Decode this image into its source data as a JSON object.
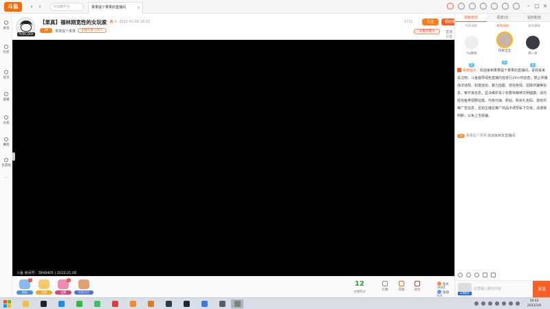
{
  "titlebar": {
    "logo": "斗鱼",
    "search_placeholder": "大仙魔平台",
    "tab_title": "果果提个果果的直播间",
    "tab_close": "×",
    "back": "‹",
    "forward": "›",
    "refresh": "↻",
    "minimize": "–",
    "maximize": "□",
    "close": "×"
  },
  "sidebar": {
    "items": [
      {
        "label": "关注",
        "icon": "heart-icon"
      },
      {
        "label": "历史",
        "icon": "clock-icon"
      },
      {
        "label": "首页",
        "icon": "home-icon"
      },
      {
        "label": "直播",
        "icon": "tv-icon"
      },
      {
        "label": "分类",
        "icon": "grid-icon"
      },
      {
        "label": "赛程",
        "icon": "trophy-icon"
      },
      {
        "label": "云游戏",
        "icon": "cloud-icon"
      }
    ],
    "more": "···"
  },
  "room": {
    "avatar_tag": "PUSH_BOX",
    "title": "【果真】福林刚宽性的女玩家",
    "heat": "🔥",
    "heat_value": "0",
    "time": "2022-01-05 16:22",
    "level_badge": "LV",
    "category": "果果提个果果",
    "tag": "主播大厦 100+",
    "views": "1711",
    "follow_label": "关注",
    "report_label": "超级弹幕",
    "fans_badge": "斗鱼大使 2",
    "share_label": "直播分享"
  },
  "video": {
    "watermark": "斗鱼 房间号：3849405 | 2022.01.06"
  },
  "bottombar": {
    "gifts": [
      {
        "label": "粉丝",
        "color": "#4a90e2",
        "badge": "5"
      },
      {
        "label": "宝箱",
        "color": "#f5a623",
        "badge": ""
      },
      {
        "label": "宝藏",
        "color": "#e0407a",
        "badge": "2"
      },
      {
        "label": "任务大厅",
        "color": "#4a6fe0",
        "badge": ""
      }
    ],
    "counter_value": "12",
    "counter_label": "主播积分",
    "icons": [
      {
        "label": "礼物",
        "icon": "gift-icon"
      },
      {
        "label": "充值",
        "icon": "flame-icon"
      },
      {
        "label": "背包",
        "icon": "bag-icon"
      }
    ],
    "balance_yuwan_label": "鱼丸",
    "balance_yuwan_value": "2602",
    "balance_yuchi_label": "鱼翅",
    "balance_yuchi_value": "0.0"
  },
  "rpanel": {
    "tabs": [
      "贡献榜单",
      "贵宾(3)",
      "钻石粉丝"
    ],
    "subtabs": [
      "今日贡献",
      "本周贡献",
      "总贡献榜"
    ],
    "fans": [
      {
        "name": "*ni悦玩",
        "level": "1"
      },
      {
        "name": "阿果宝宝",
        "level": "2"
      },
      {
        "name": "开一岁",
        "level": "3"
      }
    ],
    "chat_label": "系统提示：",
    "chat_text": "欢迎来到果果提个果果的直播间，喜欢就来关注吧。斗鱼倡导绿色直播内容进行24小时巡查，禁止传播违法违规、封建迷信、暴力血腥、低俗色情、招嫖诈骗等信息，等不良信息，坚决维护青少年群体精神文明健康。请勿轻信各类招聘征婚、代练代抽、刷钻、购买礼包码、游戏币等广告信息，且如主播在推广商品中诱导私下交易，请谨慎判断，以免上当受骗。",
    "chat2_level": "14",
    "chat2_name": "果果提个果果",
    "chat2_text": "欢迎来到本直播间",
    "input_placeholder": "这里输入聊天内容",
    "mini_avatar_label": "水滴助手",
    "send_label": "发送"
  },
  "taskbar": {
    "apps": [
      {
        "name": "explorer",
        "color": "#f0c040"
      },
      {
        "name": "app-g",
        "color": "#222222"
      },
      {
        "name": "qq",
        "color": "#1a8fe0"
      },
      {
        "name": "wechat",
        "color": "#2dbb3a"
      },
      {
        "name": "app-green",
        "color": "#3ac060"
      },
      {
        "name": "netease",
        "color": "#e03a3a"
      },
      {
        "name": "app-orange",
        "color": "#f08a2a"
      },
      {
        "name": "app-orange2",
        "color": "#e07a20"
      },
      {
        "name": "app-dark",
        "color": "#2a3a4a"
      },
      {
        "name": "steam",
        "color": "#1b2838"
      },
      {
        "name": "app-blue",
        "color": "#3a7ae0"
      },
      {
        "name": "game",
        "color": "#5a5a6a"
      },
      {
        "name": "app-active",
        "color": "#7a8a6a"
      }
    ],
    "time": "16:42",
    "date": "2022/1/6"
  },
  "colors": {
    "accent": "#ff5d23",
    "orange": "#ff7d1a",
    "video_bg": "#000000"
  }
}
